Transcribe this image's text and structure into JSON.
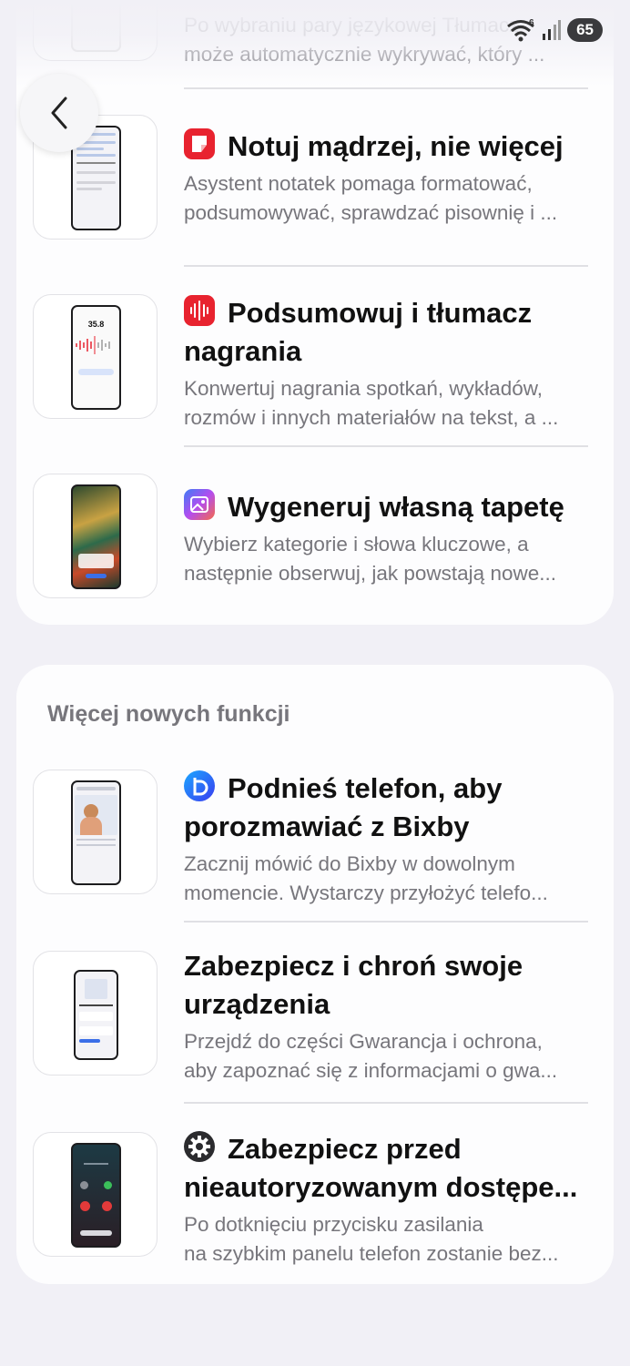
{
  "status_bar": {
    "wifi_badge": "6",
    "battery": "65"
  },
  "section1": {
    "items": [
      {
        "title": "",
        "desc_line1": "Po wybraniu pary językowej Tłumacz",
        "desc_line2": "może automatycznie wykrywać, który ..."
      },
      {
        "title": "Notuj mądrzej, nie więcej",
        "desc_line1": "Asystent notatek pomaga formatować,",
        "desc_line2": "podsumowywać, sprawdzać pisownię i ...",
        "icon": "notes-icon",
        "icon_color": "#e8232f"
      },
      {
        "title_line1": "Podsumowuj i tłumacz",
        "title_line2": "nagrania",
        "desc_line1": "Konwertuj nagrania spotkań, wykładów,",
        "desc_line2": "rozmów i innych materiałów na tekst, a ...",
        "icon": "voice-recorder-icon",
        "icon_color": "#e8232f",
        "thumb_time": "35.8"
      },
      {
        "title": "Wygeneruj własną tapetę",
        "desc_line1": "Wybierz kategorie i słowa kluczowe, a",
        "desc_line2": "następnie obserwuj, jak powstają nowe...",
        "icon": "gallery-icon"
      }
    ]
  },
  "section2": {
    "title": "Więcej nowych funkcji",
    "items": [
      {
        "title_line1": "Podnieś telefon, aby",
        "title_line2": "porozmawiać z Bixby",
        "desc_line1": "Zacznij mówić do Bixby w dowolnym",
        "desc_line2": "momencie. Wystarczy przyłożyć telefo...",
        "icon": "bixby-icon",
        "icon_color": "#1c64f2"
      },
      {
        "title_line1": "Zabezpiecz i chroń swoje",
        "title_line2": "urządzenia",
        "desc_line1": "Przejdź do części Gwarancja i ochrona,",
        "desc_line2": "aby zapoznać się z informacjami o gwa..."
      },
      {
        "title_line1": "Zabezpiecz przed",
        "title_line2": "nieautoryzowanym dostępe...",
        "desc_line1": "Po dotknięciu przycisku zasilania",
        "desc_line2": "na szybkim panelu telefon zostanie bez...",
        "icon": "settings-gear-icon",
        "icon_color": "#2b2b2e"
      }
    ]
  }
}
